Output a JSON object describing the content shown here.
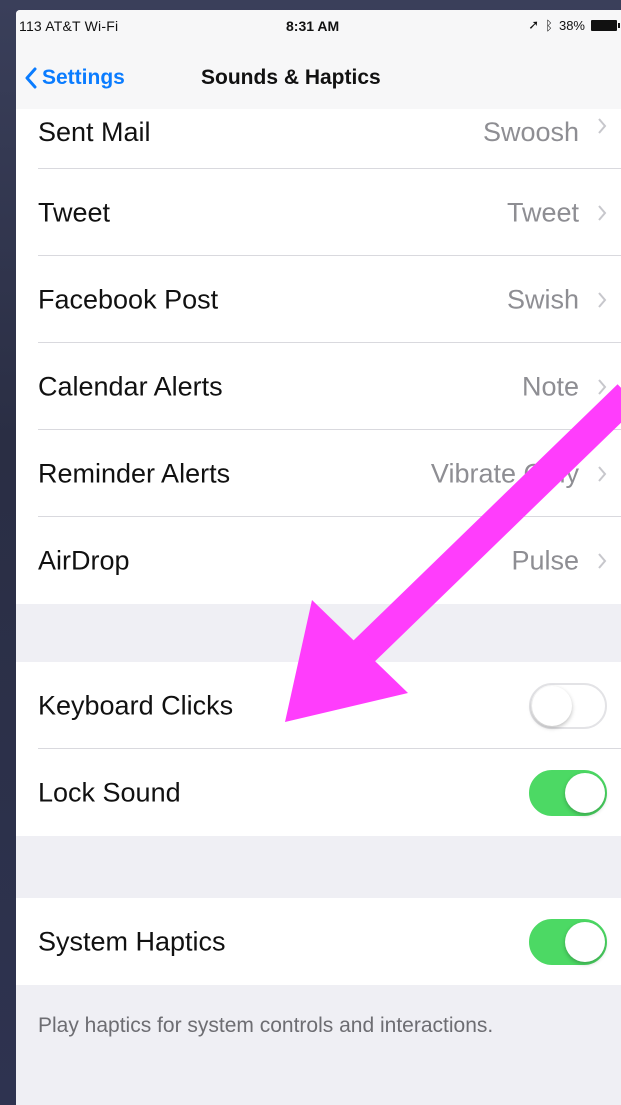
{
  "status_bar": {
    "carrier": "113 AT&T Wi-Fi",
    "time": "8:31 AM",
    "battery": "38%"
  },
  "nav": {
    "back_label": "Settings",
    "title": "Sounds & Haptics"
  },
  "sound_rows": [
    {
      "label": "Sent Mail",
      "value": "Swoosh"
    },
    {
      "label": "Tweet",
      "value": "Tweet"
    },
    {
      "label": "Facebook Post",
      "value": "Swish"
    },
    {
      "label": "Calendar Alerts",
      "value": "Note"
    },
    {
      "label": "Reminder Alerts",
      "value": "Vibrate Only"
    },
    {
      "label": "AirDrop",
      "value": "Pulse"
    }
  ],
  "toggles": {
    "keyboard_clicks": {
      "label": "Keyboard Clicks",
      "on": false
    },
    "lock_sound": {
      "label": "Lock Sound",
      "on": true
    }
  },
  "haptics": {
    "label": "System Haptics",
    "on": true,
    "footer": "Play haptics for system controls and interactions."
  },
  "colors": {
    "accent": "#0a7cff",
    "toggle_on": "#4cd964",
    "annotation_arrow": "#ff3dfc"
  }
}
